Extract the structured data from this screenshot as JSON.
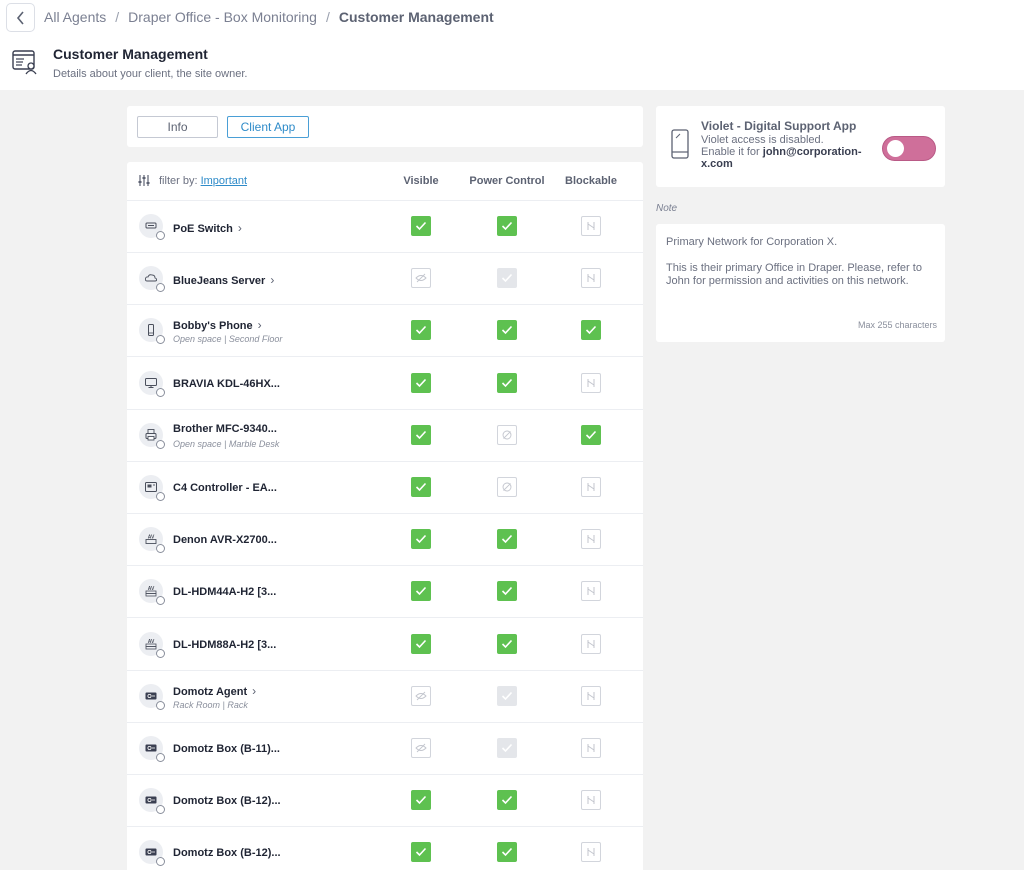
{
  "breadcrumb": [
    "All Agents",
    "Draper Office - Box Monitoring",
    "Customer Management"
  ],
  "header": {
    "title": "Customer Management",
    "subtitle": "Details about your client, the site owner."
  },
  "tabs": [
    "Info",
    "Client App"
  ],
  "active_tab": "Client App",
  "table": {
    "filter_prefix": "filter by:",
    "filter_value": "Important",
    "columns": [
      "Visible",
      "Power Control",
      "Blockable"
    ],
    "rows": [
      {
        "name": "PoE Switch",
        "chevron": true,
        "sub": "",
        "icon": "switch-icon",
        "visible": "on",
        "power": "on",
        "blockable": "off"
      },
      {
        "name": "BlueJeans Server",
        "chevron": true,
        "sub": "",
        "icon": "cloud-icon",
        "visible": "off",
        "power": "disabled",
        "blockable": "off"
      },
      {
        "name": "Bobby's Phone",
        "chevron": true,
        "sub": "Open space | Second Floor",
        "icon": "phone-icon",
        "visible": "on",
        "power": "on",
        "blockable": "on"
      },
      {
        "name": "BRAVIA KDL-46HX...",
        "chevron": false,
        "sub": "",
        "icon": "tv-icon",
        "visible": "on",
        "power": "on",
        "blockable": "off"
      },
      {
        "name": "Brother MFC-9340...",
        "chevron": false,
        "sub": "Open space | Marble Desk",
        "icon": "printer-icon",
        "visible": "on",
        "power": "off",
        "blockable": "on"
      },
      {
        "name": "C4 Controller - EA...",
        "chevron": false,
        "sub": "",
        "icon": "controller-icon",
        "visible": "on",
        "power": "off",
        "blockable": "off"
      },
      {
        "name": "Denon AVR-X2700...",
        "chevron": false,
        "sub": "",
        "icon": "av-receiver-icon",
        "visible": "on",
        "power": "on",
        "blockable": "off"
      },
      {
        "name": "DL-HDM44A-H2 [3...",
        "chevron": false,
        "sub": "",
        "icon": "av-matrix-icon",
        "visible": "on",
        "power": "on",
        "blockable": "off"
      },
      {
        "name": "DL-HDM88A-H2 [3...",
        "chevron": false,
        "sub": "",
        "icon": "av-matrix-icon",
        "visible": "on",
        "power": "on",
        "blockable": "off"
      },
      {
        "name": "Domotz Agent",
        "chevron": true,
        "sub": "Rack Room | Rack",
        "icon": "domotz-box-icon",
        "visible": "off",
        "power": "disabled",
        "blockable": "off"
      },
      {
        "name": "Domotz Box (B-11)...",
        "chevron": false,
        "sub": "",
        "icon": "domotz-box-icon",
        "visible": "off",
        "power": "disabled",
        "blockable": "off"
      },
      {
        "name": "Domotz Box (B-12)...",
        "chevron": false,
        "sub": "",
        "icon": "domotz-box-icon",
        "visible": "on",
        "power": "on",
        "blockable": "off"
      },
      {
        "name": "Domotz Box (B-12)...",
        "chevron": false,
        "sub": "",
        "icon": "domotz-box-icon",
        "visible": "on",
        "power": "on",
        "blockable": "off"
      }
    ]
  },
  "violet": {
    "title": "Violet - Digital Support App",
    "line1": "Violet access is disabled.",
    "line2_prefix": "Enable it for ",
    "email": "john@corporation-x.com",
    "toggle_color": "#cf6f9a"
  },
  "note": {
    "label": "Note",
    "text": "Primary Network for Corporation X.\n\nThis is their primary Office in Draper. Please, refer to John for permission and activities on this network.",
    "max": "Max 255 characters"
  },
  "colors": {
    "checked": "#5ec150",
    "link": "#2e8bc9",
    "disabled": "#e4e6ea"
  }
}
